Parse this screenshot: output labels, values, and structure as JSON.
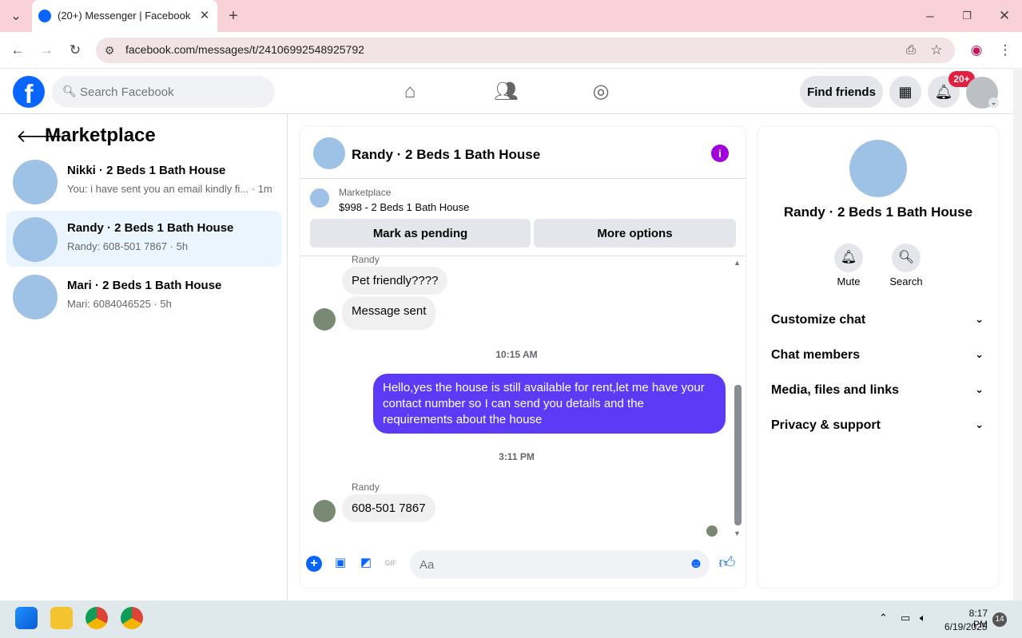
{
  "browser": {
    "tab_title": "(20+) Messenger | Facebook",
    "url": "facebook.com/messages/t/24106992548925792"
  },
  "fb_header": {
    "search_placeholder": "Search Facebook",
    "find_friends": "Find friends",
    "notif_badge": "20+"
  },
  "left": {
    "title": "Marketplace",
    "conversations": [
      {
        "name": "Nikki · 2 Beds 1 Bath House",
        "preview": "You: i have sent you an email kindly fi... · 1m",
        "active": false
      },
      {
        "name": "Randy · 2 Beds 1 Bath House",
        "preview": "Randy: 608-501 7867 · 5h",
        "active": true
      },
      {
        "name": "Mari · 2 Beds 1 Bath House",
        "preview": "Mari: 6084046525 · 5h",
        "active": false
      }
    ]
  },
  "chat": {
    "title": "Randy · 2 Beds 1 Bath House",
    "marketplace_label": "Marketplace",
    "listing": "$998 - 2 Beds 1 Bath House",
    "mark_pending": "Mark as pending",
    "more_options": "More options",
    "sender1": "Randy",
    "msg1": "Pet friendly????",
    "msg2": "Message sent",
    "time1": "10:15 AM",
    "out_msg": "Hello,yes the house is still available for rent,let me have your contact number   so I can send you details and the requirements about the house",
    "time2": "3:11 PM",
    "sender2": "Randy",
    "msg3": "608-501 7867",
    "composer_placeholder": "Aa"
  },
  "right": {
    "name": "Randy · 2 Beds 1 Bath House",
    "mute": "Mute",
    "search": "Search",
    "sections": [
      "Customize chat",
      "Chat members",
      "Media, files and links",
      "Privacy & support"
    ]
  },
  "taskbar": {
    "time": "8:17 PM",
    "date": "6/19/2025",
    "badge": "14"
  },
  "colors": {
    "fb_blue": "#0866ff",
    "outgoing_bubble": "#5b3bf6",
    "info_purple": "#a100d8",
    "tabstrip": "#f9d1d9"
  }
}
